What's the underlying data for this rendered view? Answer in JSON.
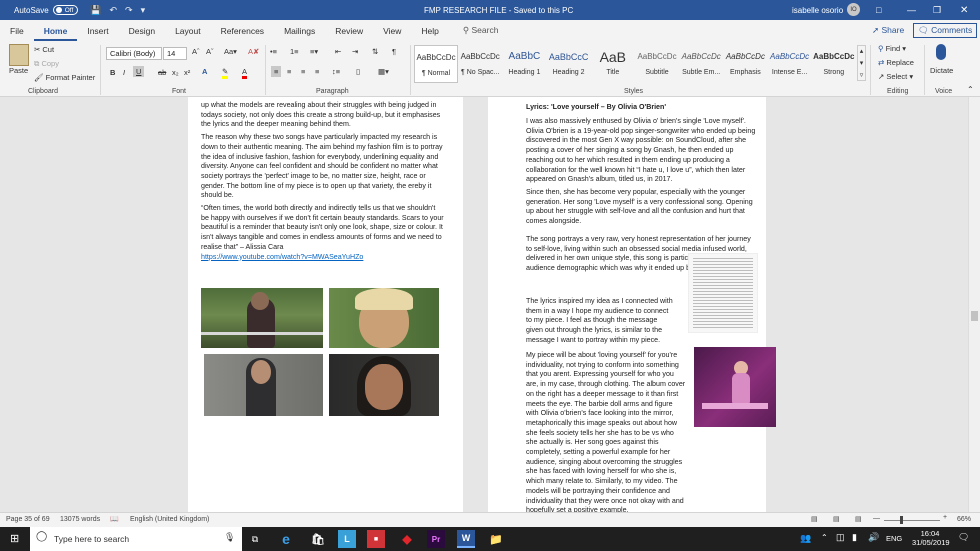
{
  "titlebar": {
    "autosave_label": "AutoSave",
    "autosave_state": "Off",
    "doc_title": "FMP RESEARCH FILE  -  Saved to this PC",
    "user_name": "isabelle osorio",
    "user_initials": "IO"
  },
  "tabs": [
    "File",
    "Home",
    "Insert",
    "Design",
    "Layout",
    "References",
    "Mailings",
    "Review",
    "View",
    "Help"
  ],
  "search_placeholder": "Search",
  "share_label": "Share",
  "comments_label": "Comments",
  "ribbon": {
    "clipboard": {
      "paste": "Paste",
      "cut": "Cut",
      "copy": "Copy",
      "format_painter": "Format Painter",
      "label": "Clipboard"
    },
    "font": {
      "name": "Calibri (Body)",
      "size": "14",
      "label": "Font"
    },
    "paragraph": {
      "label": "Paragraph"
    },
    "styles": {
      "label": "Styles",
      "items": [
        {
          "preview": "AaBbCcDc",
          "name": "¶ Normal"
        },
        {
          "preview": "AaBbCcDc",
          "name": "¶ No Spac..."
        },
        {
          "preview": "AaBbC",
          "name": "Heading 1"
        },
        {
          "preview": "AaBbCcC",
          "name": "Heading 2"
        },
        {
          "preview": "AaB",
          "name": "Title"
        },
        {
          "preview": "AaBbCcDc",
          "name": "Subtitle"
        },
        {
          "preview": "AaBbCcDc",
          "name": "Subtle Em..."
        },
        {
          "preview": "AaBbCcDc",
          "name": "Emphasis"
        },
        {
          "preview": "AaBbCcDc",
          "name": "Intense E..."
        },
        {
          "preview": "AaBbCcDc",
          "name": "Strong"
        }
      ]
    },
    "editing": {
      "find": "Find",
      "replace": "Replace",
      "select": "Select",
      "label": "Editing"
    },
    "voice": {
      "dictate": "Dictate",
      "label": "Voice"
    }
  },
  "left_page": {
    "p1": "up what the models are revealing about their struggles with being judged in todays society, not only does this create a strong build-up, but it emphasises the lyrics and the deeper meaning behind them.",
    "p2": "The reason why these two songs have particularly impacted my research is down to their authentic meaning. The aim behind my fashion film is to portray the idea of inclusive fashion, fashion for everybody, underlining equality and diversity. Anyone can feel confident and should be confident no matter what society portrays the 'perfect' image to be, no matter size, height, race or gender. The bottom line of my piece is to open up that variety, the ereby it should be.",
    "p3": "“Often times, the world both directly and indirectly tells us that we shouldn't be happy with ourselves if we don't fit certain beauty standards. Scars to your beautiful is a reminder that beauty isn't only one look, shape, size or colour. It isn't always tangible and comes in endless amounts of forms and we need to realise that” – Alissia Cara",
    "link": "https://www.youtube.com/watch?v=MWASeaYuHZo"
  },
  "right_page": {
    "heading": "Lyrics: 'Love yourself – By Olivia O'Brien'",
    "p1": "I was also massively enthused by Olivia o' brien's single 'Love myself'. Olivia O'brien is a 19-year-old pop singer-songwriter who ended up being discovered in the most Gen X way possible: on SoundCloud, after she posting a cover of her singing a song by Gnash, he then ended up reaching out to her which resulted in them ending up producing a collaboration for the well known hit “I hate u, I love u”, which then later appeared on Gnash's album, titled us, in 2017.",
    "p2": "Since then, she has become very popular, especially with the younger generation. Her song 'Love myself' is a very confessional song. Opening up about her struggle with self-love and all the confusion and hurt that comes alongside.",
    "p3": "The song portrays a very raw, very honest representation of her journey to self-love, living within such an obsessed social media infused world, delivered in her own unique style, this song is particularly relevant to her audience demographic which was why it ended up being so sucessful.",
    "p4": "The lyrics inspired my idea as I connected with them in a way I hope my audience to connect to my piece. I feel as though the message given out through the lyrics, is similar to the message I want to portray within my piece.",
    "p5": "My piece will be about 'loving yourself' for you're individuality, not trying to conform into something that you arent. Expressing yourself for who you are, in my case, through clothing. The album cover on the right has a deeper message to it than first meets the eye. The barbie doll arms and figure with Olivia o'brien's face looking into the mirror, metaphorically this image speaks out about how she feels society tells her she has to be vs who she actually is. Her song goes against this completely, setting a powerful example for her audience, singing about overcoming the struggles she has faced with loving herself for who she is, which many relate to. Similarly, to my video. The models will be portraying their confidence and individuality that they were once not okay with and hopefully set a positive  example."
  },
  "status": {
    "page": "Page 35 of 69",
    "words": "13075 words",
    "language": "English (United Kingdom)",
    "zoom": "66%"
  },
  "taskbar": {
    "search_placeholder": "Type here to search",
    "language": "ENG",
    "time": "16:04",
    "date": "31/05/2019"
  }
}
